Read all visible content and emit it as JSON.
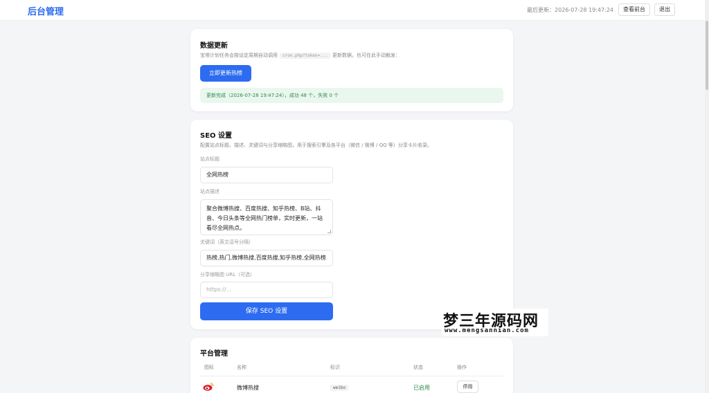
{
  "header": {
    "brand": "后台管理",
    "last_update": "最后更新：2026-07-28 19:47:24",
    "view_front_label": "查看前台",
    "logout_label": "退出"
  },
  "data_update": {
    "title": "数据更新",
    "desc_prefix": "宝塔计划任务会按设定周期自动调用",
    "desc_code": "cron.php?token=...",
    "desc_suffix": "更新数据，也可在此手动触发：",
    "button_label": "立即更新热榜",
    "notice": "更新完成（2026-07-28 19:47:24），成功 48 个，失败 0 个"
  },
  "seo": {
    "title": "SEO 设置",
    "desc": "配置站点标题、描述、关键词与分享缩略图，用于搜索引擎及各平台（微信 / 微博 / QQ 等）分享卡片收录。",
    "site_title_label": "站点标题",
    "site_title_value": "全网热榜",
    "site_desc_label": "站点描述",
    "site_desc_value": "聚合微博热搜、百度热搜、知乎热榜、B站、抖音、今日头条等全网热门榜单，实时更新，一站看尽全网热点。",
    "keywords_label": "关键词（英文逗号分隔）",
    "keywords_value": "热榜,热门,微博热搜,百度热搜,知乎热榜,全网热榜",
    "thumb_label": "分享缩略图 URL（可选）",
    "thumb_placeholder": "https://...",
    "save_label": "保存 SEO 设置"
  },
  "platforms": {
    "title": "平台管理",
    "columns": [
      "图标",
      "名称",
      "标识",
      "状态",
      "操作"
    ],
    "rows": [
      {
        "icon": "weibo-icon",
        "name": "微博热搜",
        "key": "weibo",
        "status": "已启用",
        "action": "停用"
      }
    ]
  },
  "watermark": {
    "cn": "梦三年源码网",
    "en": "www.mengsannian.com"
  },
  "colors": {
    "accent": "#2d6cf0",
    "success": "#2f8a4a",
    "success_bg": "#eaf7ee"
  }
}
